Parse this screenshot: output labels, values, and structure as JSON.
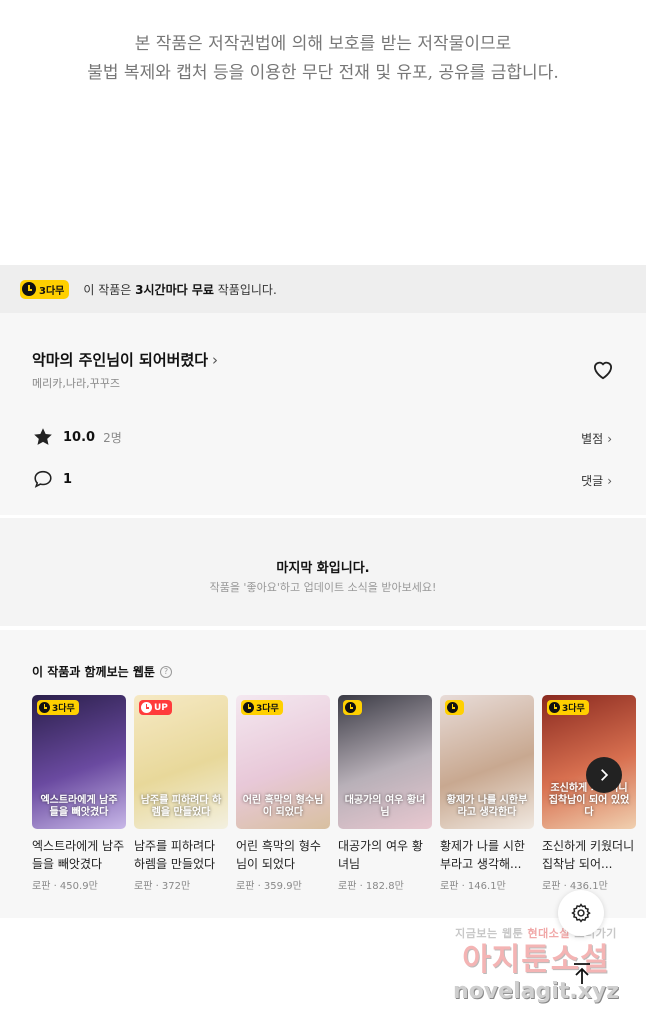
{
  "copyright": {
    "line1": "본 작품은 저작권법에 의해 보호를 받는 저작물이므로",
    "line2": "불법 복제와 캡처 등을 이용한 무단 전재 및 유포, 공유를 금합니다."
  },
  "notice": {
    "badge": "3다무",
    "prefix": "이 작품은 ",
    "emphasis": "3시간마다 무료",
    "suffix": " 작품입니다."
  },
  "work": {
    "title": "악마의 주인님이 되어버렸다",
    "authors": "메리카,나라,꾸꾸즈",
    "rating": "10.0",
    "rating_count": "2명",
    "rating_link": "별점",
    "comments": "1",
    "comments_link": "댓글"
  },
  "last_episode": {
    "title": "마지막 화입니다.",
    "subtitle": "작품을 '좋아요'하고 업데이트 소식을 받아보세요!"
  },
  "recommend": {
    "heading": "이 작품과 함께보는 웹툰",
    "help": "?",
    "items": [
      {
        "badge": "3다무",
        "badge_type": "wait",
        "cover_text": "엑스트라에게 남주들을 빼앗겼다",
        "title": "엑스트라에게 남주들을 빼앗겼다",
        "meta": "로판 · 450.9만",
        "colors": [
          "#2a1f4a",
          "#6a4aa0",
          "#c8b8e8"
        ]
      },
      {
        "badge": "UP",
        "badge_type": "up",
        "cover_text": "남주를 피하려다 하렘을 만들었다",
        "title": "남주를 피하려다 하렘을 만들었다",
        "meta": "로판 · 372만",
        "colors": [
          "#f6e9c4",
          "#e8d89a",
          "#f3f0e0"
        ]
      },
      {
        "badge": "3다무",
        "badge_type": "wait",
        "cover_text": "어린 흑막의 형수님이 되었다",
        "title": "어린 흑막의 형수님이 되었다",
        "meta": "로판 · 359.9만",
        "colors": [
          "#f4e8f0",
          "#e8c8d8",
          "#d8c0a0"
        ]
      },
      {
        "badge": "",
        "badge_type": "wait",
        "cover_text": "대공가의 여우 황녀님",
        "title": "대공가의 여우 황녀님",
        "meta": "로판 · 182.8만",
        "colors": [
          "#3a3a44",
          "#b8b0b8",
          "#e8c8d0"
        ]
      },
      {
        "badge": "",
        "badge_type": "wait",
        "cover_text": "황제가 나를 시한부라고 생각한다",
        "title": "황제가 나를 시한부라고 생각해...",
        "meta": "로판 · 146.1만",
        "colors": [
          "#e8dcd8",
          "#c8a890",
          "#f0e8e0"
        ]
      },
      {
        "badge": "3다무",
        "badge_type": "wait",
        "cover_text": "조신하게 키웠더니 집착남이 되어 있었다",
        "title": "조신하게 키웠더니 집착남 되어...",
        "meta": "로판 · 436.1만",
        "colors": [
          "#8a2a20",
          "#d87050",
          "#f0d0b0"
        ]
      }
    ]
  },
  "watermark": {
    "line1a": "지금보는",
    "line1b": "웹툰",
    "line1c": "현대소설",
    "line1d": "보러가기",
    "line2": "아지툰소설",
    "line3": "novelagit.xyz"
  },
  "accent": "#ffd000"
}
